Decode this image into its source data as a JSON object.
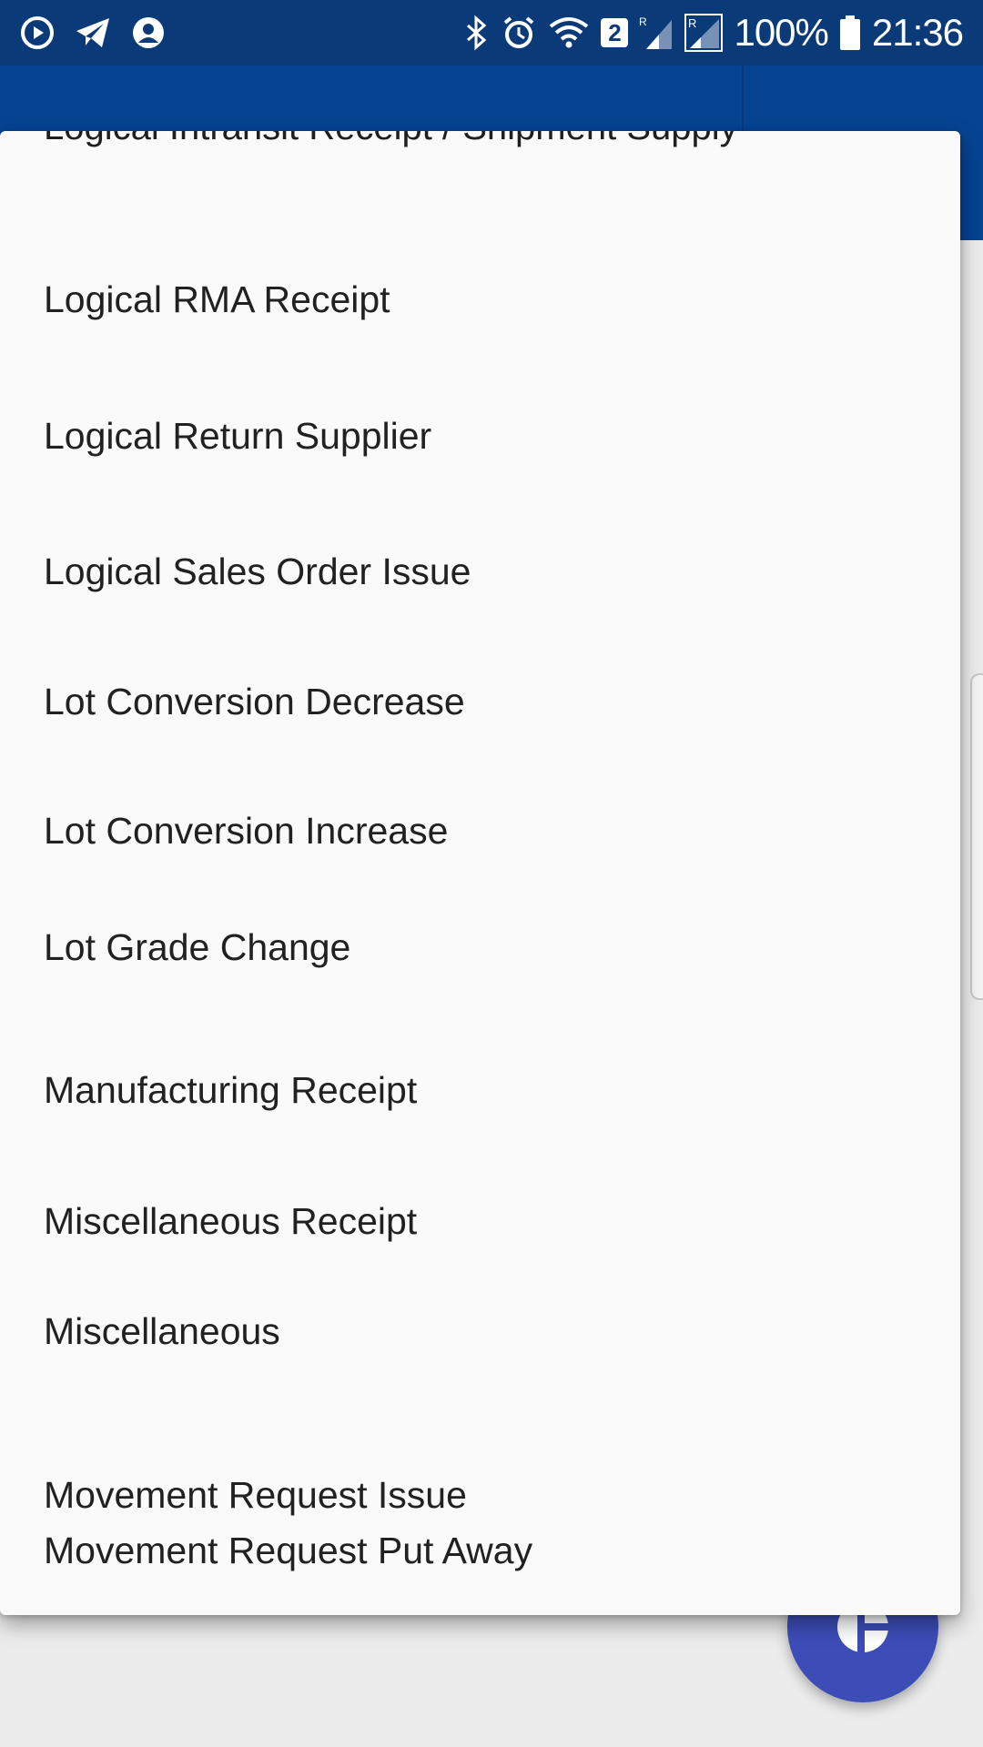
{
  "status_bar": {
    "battery": "100%",
    "time": "21:36",
    "notification_badge": "2",
    "left_icons": [
      "play-circle-icon",
      "telegram-icon",
      "account-circle-icon"
    ],
    "right_icons": [
      "bluetooth-icon",
      "alarm-icon",
      "wifi-icon",
      "signal-icon",
      "signal-icon",
      "battery-icon"
    ]
  },
  "colors": {
    "status_bar": "#0a3a78",
    "app_bar": "#064391",
    "menu_bg": "#fafafa",
    "fab": "#3d4db8"
  },
  "menu": {
    "partially_visible_item": "Logical Intransit Receipt / Shipment Supply",
    "items": [
      {
        "label": "Logical RMA Receipt"
      },
      {
        "label": "Logical Return Supplier"
      },
      {
        "label": "Logical Sales Order Issue"
      },
      {
        "label": "Lot Conversion Decrease"
      },
      {
        "label": "Lot Conversion Increase"
      },
      {
        "label": "Lot Grade Change"
      },
      {
        "label": "Manufacturing Receipt"
      },
      {
        "label": "Miscellaneous Receipt"
      },
      {
        "label": "Miscellaneous"
      },
      {
        "label": "Movement Request Issue"
      },
      {
        "label": "Movement Request Put Away"
      }
    ]
  }
}
